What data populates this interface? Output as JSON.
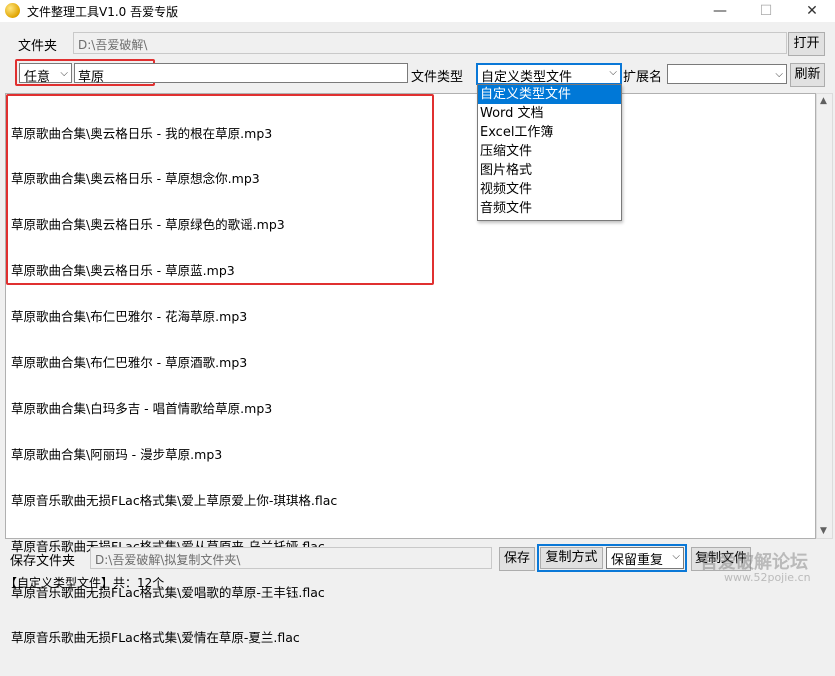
{
  "window": {
    "title": "文件整理工具V1.0 吾爱专版",
    "minimize": "—",
    "maximize": "☐",
    "close": "✕"
  },
  "folder": {
    "label": "文件夹",
    "path": "D:\\吾爱破解\\",
    "open_button": "打开"
  },
  "filter": {
    "match_mode": "任意",
    "keyword": "草原",
    "file_type_label": "文件类型",
    "file_type_selected": "自定义类型文件",
    "ext_label": "扩展名",
    "ext_value": "",
    "refresh_button": "刷新"
  },
  "file_type_options": [
    "自定义类型文件",
    "Word 文档",
    "Excel工作簿",
    "压缩文件",
    "图片格式",
    "视频文件",
    "音频文件"
  ],
  "results": [
    "草原歌曲合集\\奥云格日乐 - 我的根在草原.mp3",
    "草原歌曲合集\\奥云格日乐 - 草原想念你.mp3",
    "草原歌曲合集\\奥云格日乐 - 草原绿色的歌谣.mp3",
    "草原歌曲合集\\奥云格日乐 - 草原蓝.mp3",
    "草原歌曲合集\\布仁巴雅尔 - 花海草原.mp3",
    "草原歌曲合集\\布仁巴雅尔 - 草原酒歌.mp3",
    "草原歌曲合集\\白玛多吉 - 唱首情歌给草原.mp3",
    "草原歌曲合集\\阿丽玛 - 漫步草原.mp3",
    "草原音乐歌曲无损FLac格式集\\爱上草原爱上你-琪琪格.flac",
    "草原音乐歌曲无损FLac格式集\\爱从草原来-乌兰托娅.flac",
    "草原音乐歌曲无损FLac格式集\\爱唱歌的草原-王丰钰.flac",
    "草原音乐歌曲无损FLac格式集\\爱情在草原-夏兰.flac"
  ],
  "save": {
    "label": "保存文件夹",
    "path": "D:\\吾爱破解\\拟复制文件夹\\",
    "save_button": "保存",
    "copy_mode_label": "复制方式",
    "copy_mode_value": "保留重复",
    "copy_button": "复制文件"
  },
  "status": {
    "text": "【自定义类型文件】共：12个"
  },
  "watermark": {
    "line1": "吾爱破解论坛",
    "line2": "www.52pojie.cn"
  }
}
